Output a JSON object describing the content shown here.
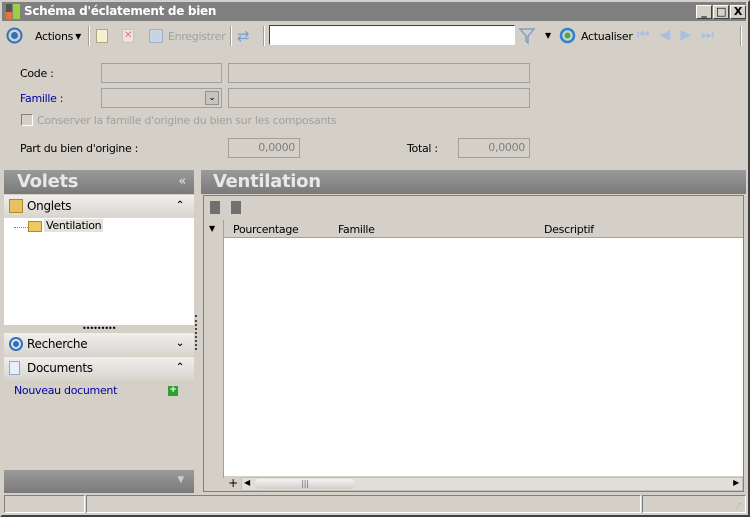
{
  "window": {
    "title": "Schéma d'éclatement de bien",
    "minimize": "_",
    "maximize": "□",
    "close": "X"
  },
  "toolbar": {
    "actions_label": "Actions",
    "save_label": "Enregistrer",
    "search_value": "",
    "refresh_label": "Actualiser"
  },
  "form": {
    "code_label": "Code :",
    "famille_label": "Famille :",
    "checkbox_label": "Conserver la famille d'origine du bien sur les composants",
    "checkbox_checked": false,
    "part_label": "Part du bien d'origine :",
    "part_value": "0,0000",
    "total_label": "Total :",
    "total_value": "0,0000",
    "code_value": "",
    "code_desc": "",
    "famille_value": "",
    "famille_desc": ""
  },
  "left_panel": {
    "title": "Volets",
    "collapse": "«",
    "sections": {
      "onglets": "Onglets",
      "recherche": "Recherche",
      "documents": "Documents"
    },
    "tree": [
      "Ventilation"
    ],
    "new_document": "Nouveau document"
  },
  "right_panel": {
    "title": "Ventilation",
    "columns": [
      "Pourcentage",
      "Famille",
      "Descriptif"
    ],
    "rows": []
  },
  "colors": {
    "link": "#0000a0",
    "header_gray": "#808080"
  }
}
